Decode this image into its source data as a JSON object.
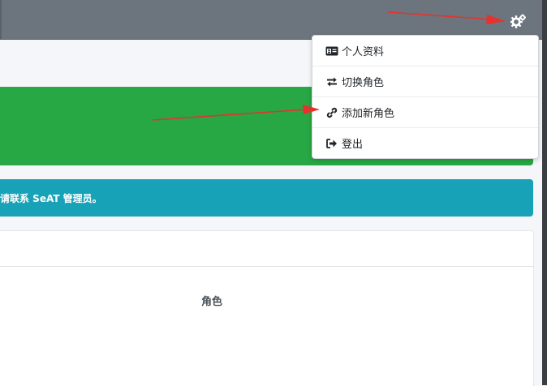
{
  "header": {
    "settings_icon": "gears-icon",
    "bar_color": "#6c757d"
  },
  "user_menu": {
    "items": [
      {
        "label": "个人资料",
        "icon": "id-card-icon"
      },
      {
        "label": "切换角色",
        "icon": "exchange-icon"
      },
      {
        "label": "添加新角色",
        "icon": "link-icon"
      },
      {
        "label": "登出",
        "icon": "sign-out-icon"
      }
    ]
  },
  "alerts": {
    "success_color": "#28a745",
    "info_color": "#17a2b8",
    "info_text": "请联系 SeAT 管理员。"
  },
  "card": {
    "column_title": "角色"
  },
  "annotation_color": "#e5322d"
}
